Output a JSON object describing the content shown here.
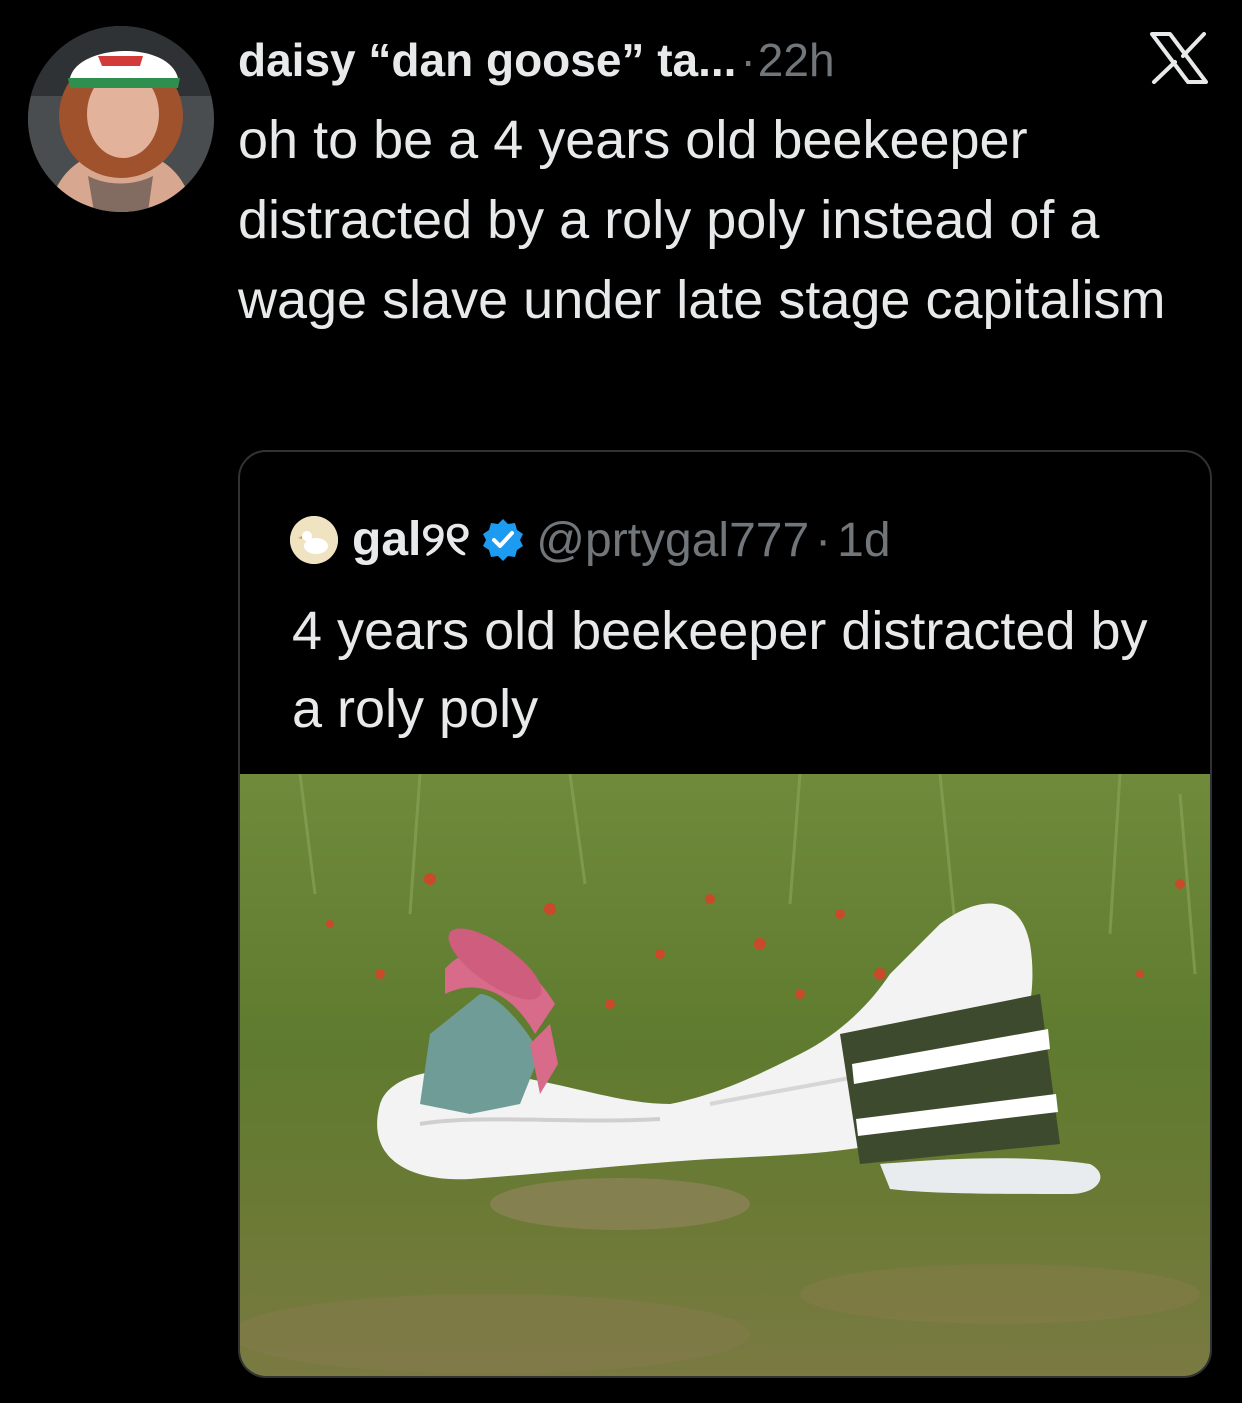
{
  "tweet": {
    "author_name": "daisy “dan goose” ta...",
    "separator": "·",
    "time": "22h",
    "text": "oh to be a 4 years old beekeeper distracted by a roly poly instead of a wage slave under late stage capitalism"
  },
  "quote": {
    "author_name": "gal୨୧",
    "handle": "@prtygal777",
    "separator": "·",
    "time": "1d",
    "text": "4 years old beekeeper distracted by a roly poly"
  },
  "icons": {
    "close": "x-logo-icon",
    "verified": "verified-badge-icon"
  },
  "colors": {
    "background": "#000000",
    "text": "#e7e9ea",
    "muted": "#71767b",
    "border": "#2f3336",
    "verified_blue": "#1d9bf0"
  }
}
